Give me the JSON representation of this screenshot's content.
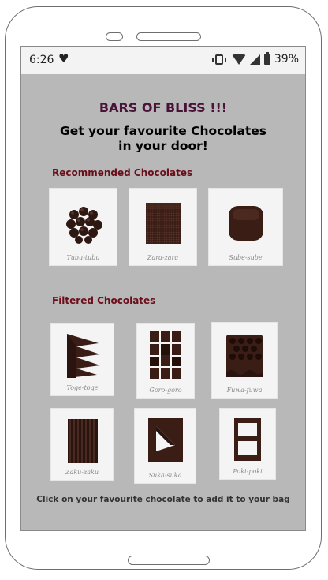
{
  "status_bar": {
    "time": "6:26",
    "battery_percent": "39%",
    "icons": [
      "heart-icon",
      "vibrate-icon",
      "wifi-icon",
      "signal-icon",
      "battery-icon"
    ]
  },
  "header": {
    "brand": "BARS OF BLISS !!!",
    "headline_line1": "Get your favourite Chocolates",
    "headline_line2": "in your door!"
  },
  "recommended": {
    "title": "Recommended Chocolates",
    "items": [
      {
        "label": "Tubu-tubu"
      },
      {
        "label": "Zara-zara"
      },
      {
        "label": "Sube-sube"
      }
    ]
  },
  "filtered": {
    "title": "Filtered Chocolates",
    "items": [
      {
        "label": "Toge-toge"
      },
      {
        "label": "Goro-goro"
      },
      {
        "label": "Fuwa-fuwa"
      },
      {
        "label": "Zaku-zaku"
      },
      {
        "label": "Suka-suka"
      },
      {
        "label": "Poki-poki"
      }
    ]
  },
  "footer": {
    "hint": "Click on your favourite chocolate to add it to your bag"
  },
  "colors": {
    "screen_bg": "#b8b8b8",
    "brand": "#4a1238",
    "section_title": "#6b0e1a",
    "chocolate": "#3a1e16"
  }
}
